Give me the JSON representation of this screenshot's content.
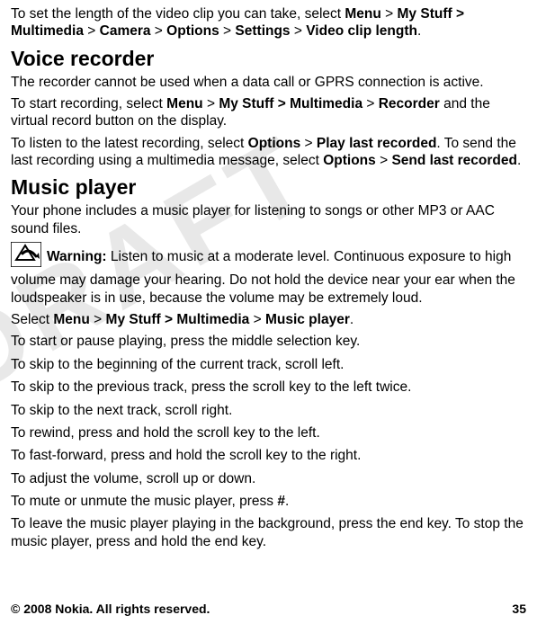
{
  "watermark": "DRAFT",
  "p1": {
    "t1": "To set the length of the video clip you can take, select ",
    "menu": "Menu",
    "gt": " > ",
    "mystuff": "My Stuff > Multimedia",
    "camera": "Camera",
    "options": "Options",
    "settings": "Settings",
    "vcl": "Video clip length",
    "dot": "."
  },
  "h_voice": "Voice recorder",
  "v1": "The recorder cannot be used when a data call or GPRS connection is active.",
  "v2": {
    "a": "To start recording, select ",
    "menu": "Menu",
    "gt": " > ",
    "mystuff": "My Stuff > Multimedia",
    "rec": "Recorder",
    "b": " and the virtual record button on the display."
  },
  "v3": {
    "a": "To listen to the latest recording, select ",
    "opt": "Options",
    "gt": " > ",
    "play": "Play last recorded",
    "b": ". To send the last recording using a multimedia message, select ",
    "send": "Send last recorded",
    "dot": "."
  },
  "h_music": "Music player",
  "m1": "Your phone includes a music player for listening to songs or other MP3 or AAC sound files.",
  "warn": {
    "label": "Warning:  ",
    "text": "Listen to music at a moderate level. Continuous exposure to high volume may damage your hearing. Do not hold the device near your ear when the loudspeaker is in use, because the volume may be extremely loud."
  },
  "m2": {
    "a": "Select ",
    "menu": "Menu",
    "gt": " > ",
    "mystuff": "My Stuff > Multimedia",
    "mp": "Music player",
    "dot": "."
  },
  "m3": "To start or pause playing, press the middle selection key.",
  "m4": "To skip to the beginning of the current track, scroll left.",
  "m5": "To skip to the previous track, press the scroll key to the left twice.",
  "m6": "To skip to the next track, scroll right.",
  "m7": "To rewind, press and hold the scroll key to the left.",
  "m8": "To fast-forward, press and hold the scroll key to the right.",
  "m9": "To adjust the volume, scroll up or down.",
  "m10": {
    "a": "To mute or unmute the music player, press ",
    "hash": "#",
    "dot": "."
  },
  "m11": "To leave the music player playing in the background, press the end key. To stop the music player, press and hold the end key.",
  "footer": {
    "copy": "© 2008 Nokia. All rights reserved.",
    "page": "35"
  }
}
